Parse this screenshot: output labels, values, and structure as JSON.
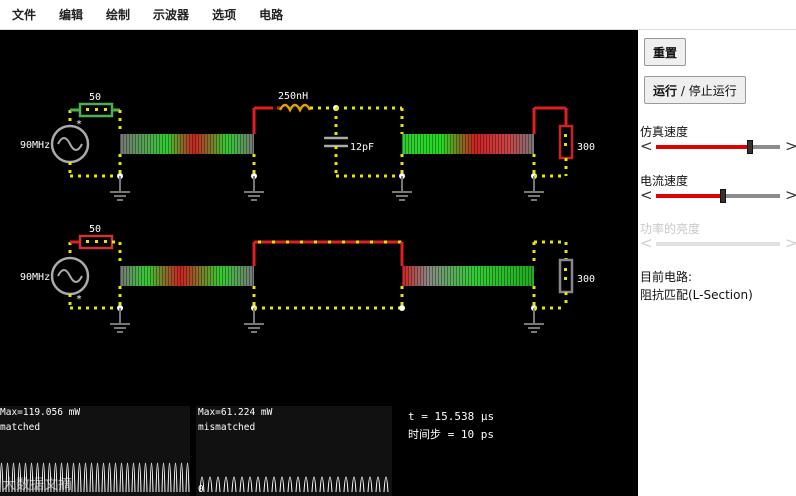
{
  "menu": [
    "文件",
    "编辑",
    "绘制",
    "示波器",
    "选项",
    "电路"
  ],
  "circuit": {
    "top": {
      "source_label": "90MHz",
      "source_resistor": "50",
      "inductor": "250nH",
      "capacitor": "12pF",
      "load": "300",
      "marker": "*"
    },
    "bottom": {
      "source_label": "90MHz",
      "source_resistor": "50",
      "load": "300",
      "marker": "*"
    }
  },
  "scopes": {
    "left": {
      "max": "Max=119.056 mW",
      "label": "matched"
    },
    "right": {
      "max": "Max=61.224 mW",
      "label": "mismatched",
      "zero": "0"
    }
  },
  "info": {
    "time": "t = 15.538 µs",
    "timestep": "时间步 = 10 ps"
  },
  "watermark": "大数据文摘",
  "panel": {
    "reset_button": "重置",
    "run_button_bold": "运行",
    "run_button_rest": " / 停止运行",
    "sim_speed_label": "仿真速度",
    "sim_speed_value": 0.76,
    "current_speed_label": "电流速度",
    "current_speed_value": 0.54,
    "power_brightness_label": "功率的亮度",
    "current_circuit_label": "目前电路:",
    "current_circuit_value": "阻抗匹配(L-Section)"
  },
  "colors": {
    "wire_yellow": "#e6e600",
    "wire_green": "#4caf50",
    "wire_red": "#e02020",
    "line_green": "#33cc33",
    "line_red": "#dd2222",
    "line_gray": "#888888"
  }
}
